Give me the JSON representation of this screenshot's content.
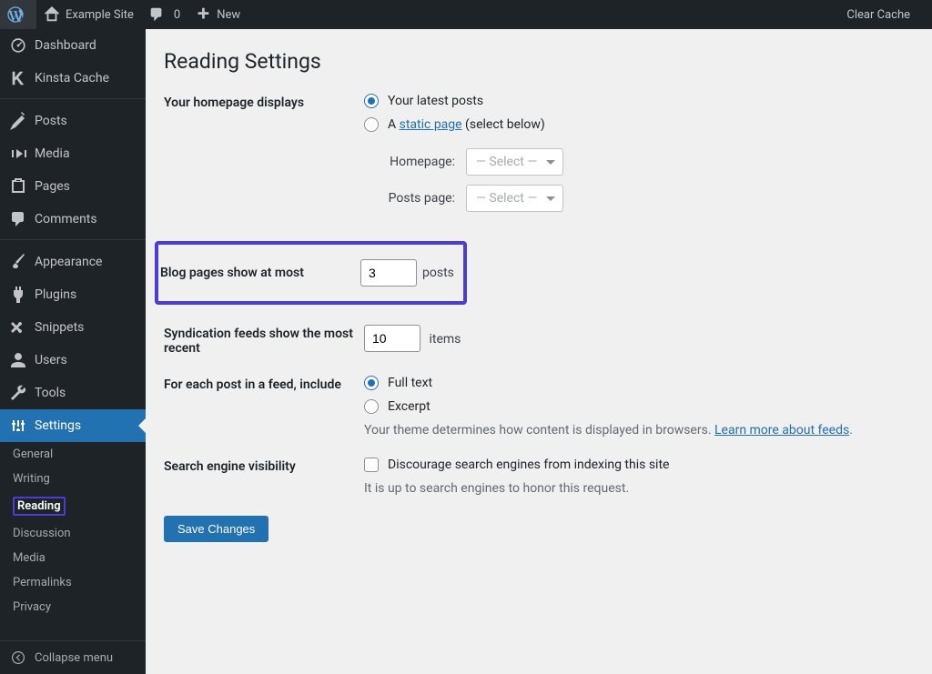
{
  "adminbar": {
    "site_name": "Example Site",
    "comments_count": "0",
    "new_label": "New",
    "clear_cache": "Clear Cache"
  },
  "sidebar": {
    "items": [
      {
        "label": "Dashboard"
      },
      {
        "label": "Kinsta Cache"
      },
      {
        "label": "Posts"
      },
      {
        "label": "Media"
      },
      {
        "label": "Pages"
      },
      {
        "label": "Comments"
      },
      {
        "label": "Appearance"
      },
      {
        "label": "Plugins"
      },
      {
        "label": "Snippets"
      },
      {
        "label": "Users"
      },
      {
        "label": "Tools"
      },
      {
        "label": "Settings"
      }
    ],
    "settings_sub": [
      {
        "label": "General"
      },
      {
        "label": "Writing"
      },
      {
        "label": "Reading"
      },
      {
        "label": "Discussion"
      },
      {
        "label": "Media"
      },
      {
        "label": "Permalinks"
      },
      {
        "label": "Privacy"
      }
    ],
    "collapse": "Collapse menu"
  },
  "page": {
    "title": "Reading Settings",
    "homepage_row": {
      "label": "Your homepage displays",
      "latest": "Your latest posts",
      "static_prefix": "A ",
      "static_link": "static page",
      "static_suffix": " (select below)",
      "homepage_label": "Homepage:",
      "postspage_label": "Posts page:",
      "select_placeholder": "— Select —"
    },
    "blog_row": {
      "label": "Blog pages show at most",
      "value": "3",
      "unit": "posts"
    },
    "feed_row": {
      "label": "Syndication feeds show the most recent",
      "value": "10",
      "unit": "items"
    },
    "feedmode_row": {
      "label": "For each post in a feed, include",
      "full": "Full text",
      "excerpt": "Excerpt",
      "desc_prefix": "Your theme determines how content is displayed in browsers. ",
      "desc_link": "Learn more about feeds"
    },
    "visibility_row": {
      "label": "Search engine visibility",
      "checkbox_label": "Discourage search engines from indexing this site",
      "desc": "It is up to search engines to honor this request."
    },
    "save": "Save Changes"
  }
}
